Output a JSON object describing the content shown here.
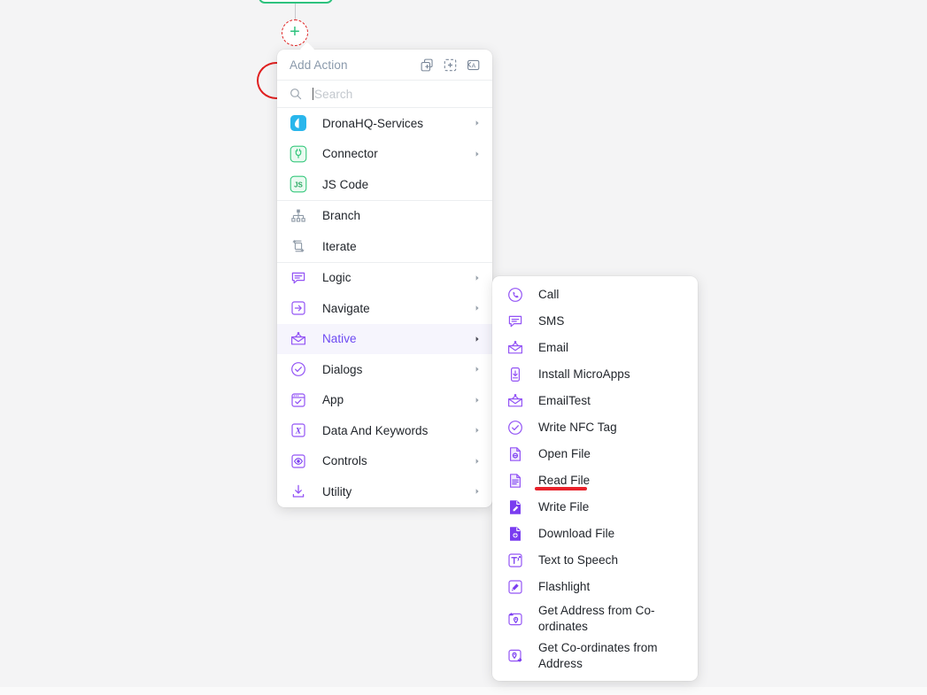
{
  "canvas": {
    "plus_button_label": "+",
    "annotation_color": "#e02020",
    "node_color": "#2ec27e"
  },
  "popup": {
    "title": "Add Action",
    "header_icons": [
      {
        "name": "duplicate-add-icon",
        "label": "Duplicate"
      },
      {
        "name": "add-group-icon",
        "label": "Add Group"
      },
      {
        "name": "rename-icon",
        "label": "Rename"
      }
    ],
    "search": {
      "placeholder": "Search",
      "value": "",
      "icon": "search-icon"
    },
    "groups": [
      {
        "items": [
          {
            "label": "DronaHQ-Services",
            "icon": "dronahq-icon",
            "has_submenu": true,
            "active": false
          },
          {
            "label": "Connector",
            "icon": "connector-plug-icon",
            "has_submenu": true,
            "active": false
          },
          {
            "label": "JS Code",
            "icon": "js-code-icon",
            "has_submenu": false,
            "active": false
          }
        ]
      },
      {
        "items": [
          {
            "label": "Branch",
            "icon": "branch-icon",
            "has_submenu": false,
            "active": false
          },
          {
            "label": "Iterate",
            "icon": "iterate-loop-icon",
            "has_submenu": false,
            "active": false
          }
        ]
      },
      {
        "items": [
          {
            "label": "Logic",
            "icon": "logic-message-icon",
            "has_submenu": true,
            "active": false
          },
          {
            "label": "Navigate",
            "icon": "navigate-arrow-icon",
            "has_submenu": true,
            "active": false
          },
          {
            "label": "Native",
            "icon": "native-envelope-icon",
            "has_submenu": true,
            "active": true
          },
          {
            "label": "Dialogs",
            "icon": "dialogs-check-circle-icon",
            "has_submenu": true,
            "active": false
          },
          {
            "label": "App",
            "icon": "app-window-icon",
            "has_submenu": true,
            "active": false
          },
          {
            "label": "Data And Keywords",
            "icon": "data-keywords-x-icon",
            "has_submenu": true,
            "active": false
          },
          {
            "label": "Controls",
            "icon": "controls-eye-icon",
            "has_submenu": true,
            "active": false
          },
          {
            "label": "Utility",
            "icon": "utility-download-icon",
            "has_submenu": true,
            "active": false
          }
        ]
      }
    ]
  },
  "submenu": {
    "parent": "Native",
    "items": [
      {
        "label": "Call",
        "icon": "phone-circle-icon"
      },
      {
        "label": "SMS",
        "icon": "sms-bubble-icon"
      },
      {
        "label": "Email",
        "icon": "email-envelope-icon"
      },
      {
        "label": "Install MicroApps",
        "icon": "install-phone-icon"
      },
      {
        "label": "EmailTest",
        "icon": "email-envelope-icon"
      },
      {
        "label": "Write NFC Tag",
        "icon": "nfc-check-circle-icon"
      },
      {
        "label": "Open File",
        "icon": "open-file-icon"
      },
      {
        "label": "Read File",
        "icon": "read-file-icon",
        "annotated": true
      },
      {
        "label": "Write File",
        "icon": "write-file-icon"
      },
      {
        "label": "Download File",
        "icon": "download-file-icon"
      },
      {
        "label": "Text to Speech",
        "icon": "text-to-speech-icon"
      },
      {
        "label": "Flashlight",
        "icon": "flashlight-icon"
      },
      {
        "label": "Get Address from Co-ordinates",
        "icon": "address-from-coords-icon"
      },
      {
        "label": "Get Co-ordinates from Address",
        "icon": "coords-from-address-icon"
      }
    ],
    "annotation": {
      "type": "underline",
      "target": "Read File",
      "color": "#e8212a"
    }
  }
}
